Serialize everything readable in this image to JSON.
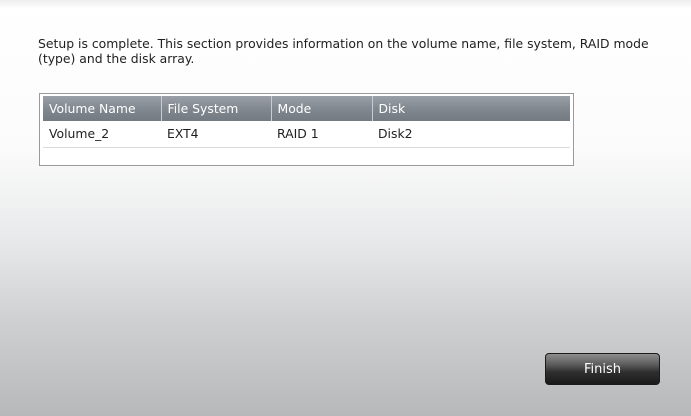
{
  "description": "Setup is complete. This section provides information on the volume name, file system, RAID mode (type) and the disk array.",
  "table": {
    "columns": [
      "Volume Name",
      "File System",
      "Mode",
      "Disk"
    ],
    "rows": [
      [
        "Volume_2",
        "EXT4",
        "RAID 1",
        "Disk2"
      ]
    ]
  },
  "buttons": {
    "finish_label": "Finish"
  },
  "colors": {
    "header_bg": "#828890",
    "button_bg": "#2f2f2f"
  }
}
